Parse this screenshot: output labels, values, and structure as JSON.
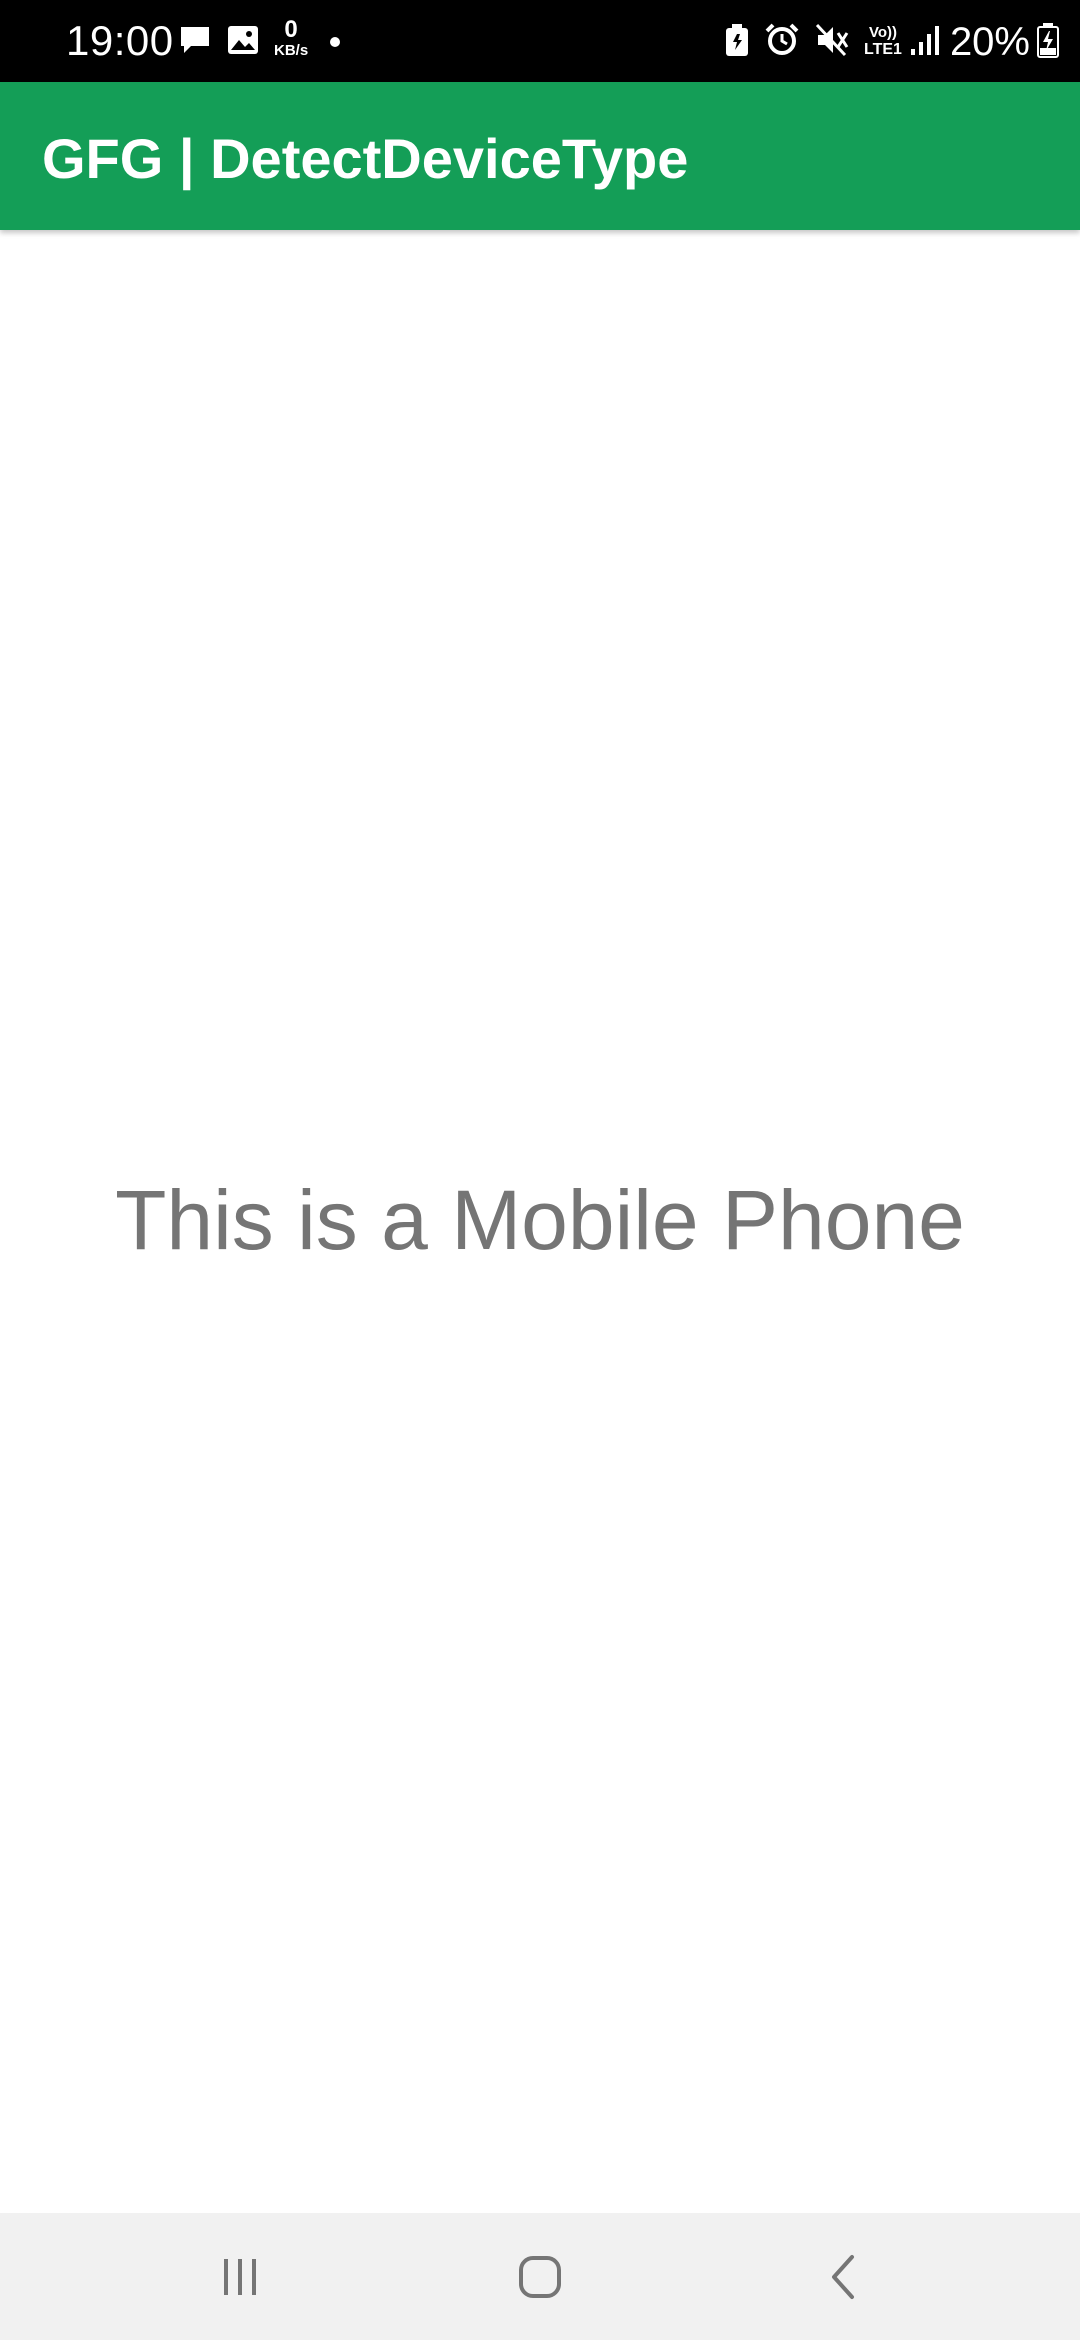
{
  "status_bar": {
    "time": "19:00",
    "net_speed_value": "0",
    "net_speed_unit": "KB/s",
    "volte_top": "Vo))",
    "volte_bottom": "LTE1",
    "battery_percent": "20%",
    "icons": [
      "message-icon",
      "image-icon",
      "notification-dot-icon",
      "battery-saver-icon",
      "alarm-icon",
      "mute-icon",
      "signal-icon",
      "battery-icon"
    ]
  },
  "app_bar": {
    "title": "GFG | DetectDeviceType",
    "color": "#149e57"
  },
  "main": {
    "device_message": "This is a Mobile Phone"
  },
  "nav_bar": {
    "buttons": [
      "recent-apps-icon",
      "home-icon",
      "back-icon"
    ]
  },
  "colors": {
    "status_bar": "#000000",
    "app_bar": "#149e57",
    "text_gray": "#757575",
    "nav_bar": "#f1f1f1"
  }
}
